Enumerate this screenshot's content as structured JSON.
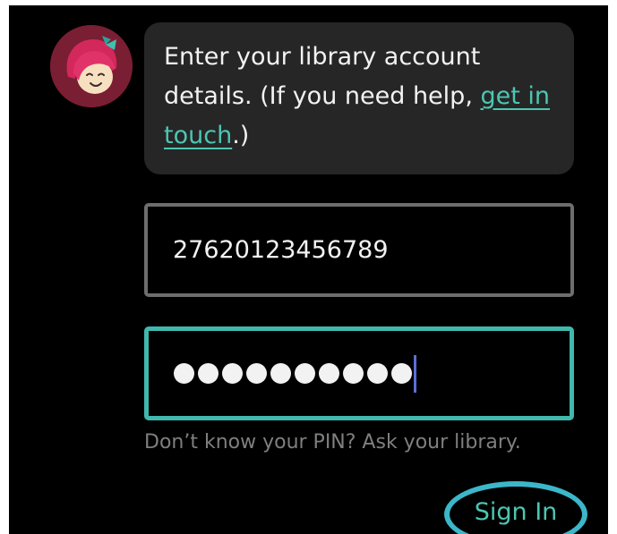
{
  "message": {
    "text_before": "Enter your library account details. (If you need help, ",
    "link_text": "get in touch",
    "text_after": ".)"
  },
  "form": {
    "card_number_value": "27620123456789",
    "pin_masked_length": 10,
    "pin_hint": "Don’t know your PIN? Ask your library.",
    "sign_in_label": "Sign In"
  },
  "colors": {
    "accent": "#4cc6b2",
    "focus_border": "#40b8ae",
    "avatar_bg": "#7a1e33",
    "bubble_bg": "#262626"
  },
  "icons": {
    "avatar": "libby-character-icon"
  }
}
